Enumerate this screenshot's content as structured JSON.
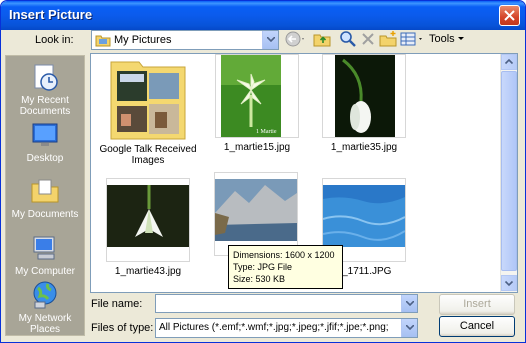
{
  "window": {
    "title": "Insert Picture"
  },
  "lookin": {
    "label": "Look in:",
    "value": "My Pictures"
  },
  "toolbar": {
    "tools_label": "Tools"
  },
  "places": [
    {
      "label": "My Recent Documents",
      "icon": "recent-documents-icon"
    },
    {
      "label": "Desktop",
      "icon": "desktop-icon"
    },
    {
      "label": "My Documents",
      "icon": "my-documents-icon"
    },
    {
      "label": "My Computer",
      "icon": "my-computer-icon"
    },
    {
      "label": "My Network Places",
      "icon": "network-places-icon"
    }
  ],
  "files": [
    {
      "name": "Google Talk Received Images",
      "type": "folder"
    },
    {
      "name": "1_martie15.jpg",
      "type": "image"
    },
    {
      "name": "1_martie35.jpg",
      "type": "image"
    },
    {
      "name": "1_martie43.jpg",
      "type": "image"
    },
    {
      "name": "",
      "type": "image"
    },
    {
      "name": "0_1711.JPG",
      "type": "image"
    }
  ],
  "tooltip": {
    "dimensions": "Dimensions: 1600 x 1200",
    "type": "Type: JPG File",
    "size": "Size: 530 KB"
  },
  "filename": {
    "label": "File name:",
    "value": ""
  },
  "filetype": {
    "label": "Files of type:",
    "value": "All Pictures (*.emf;*.wmf;*.jpg;*.jpeg;*.jfif;*.jpe;*.png;"
  },
  "buttons": {
    "insert": "Insert",
    "cancel": "Cancel"
  }
}
